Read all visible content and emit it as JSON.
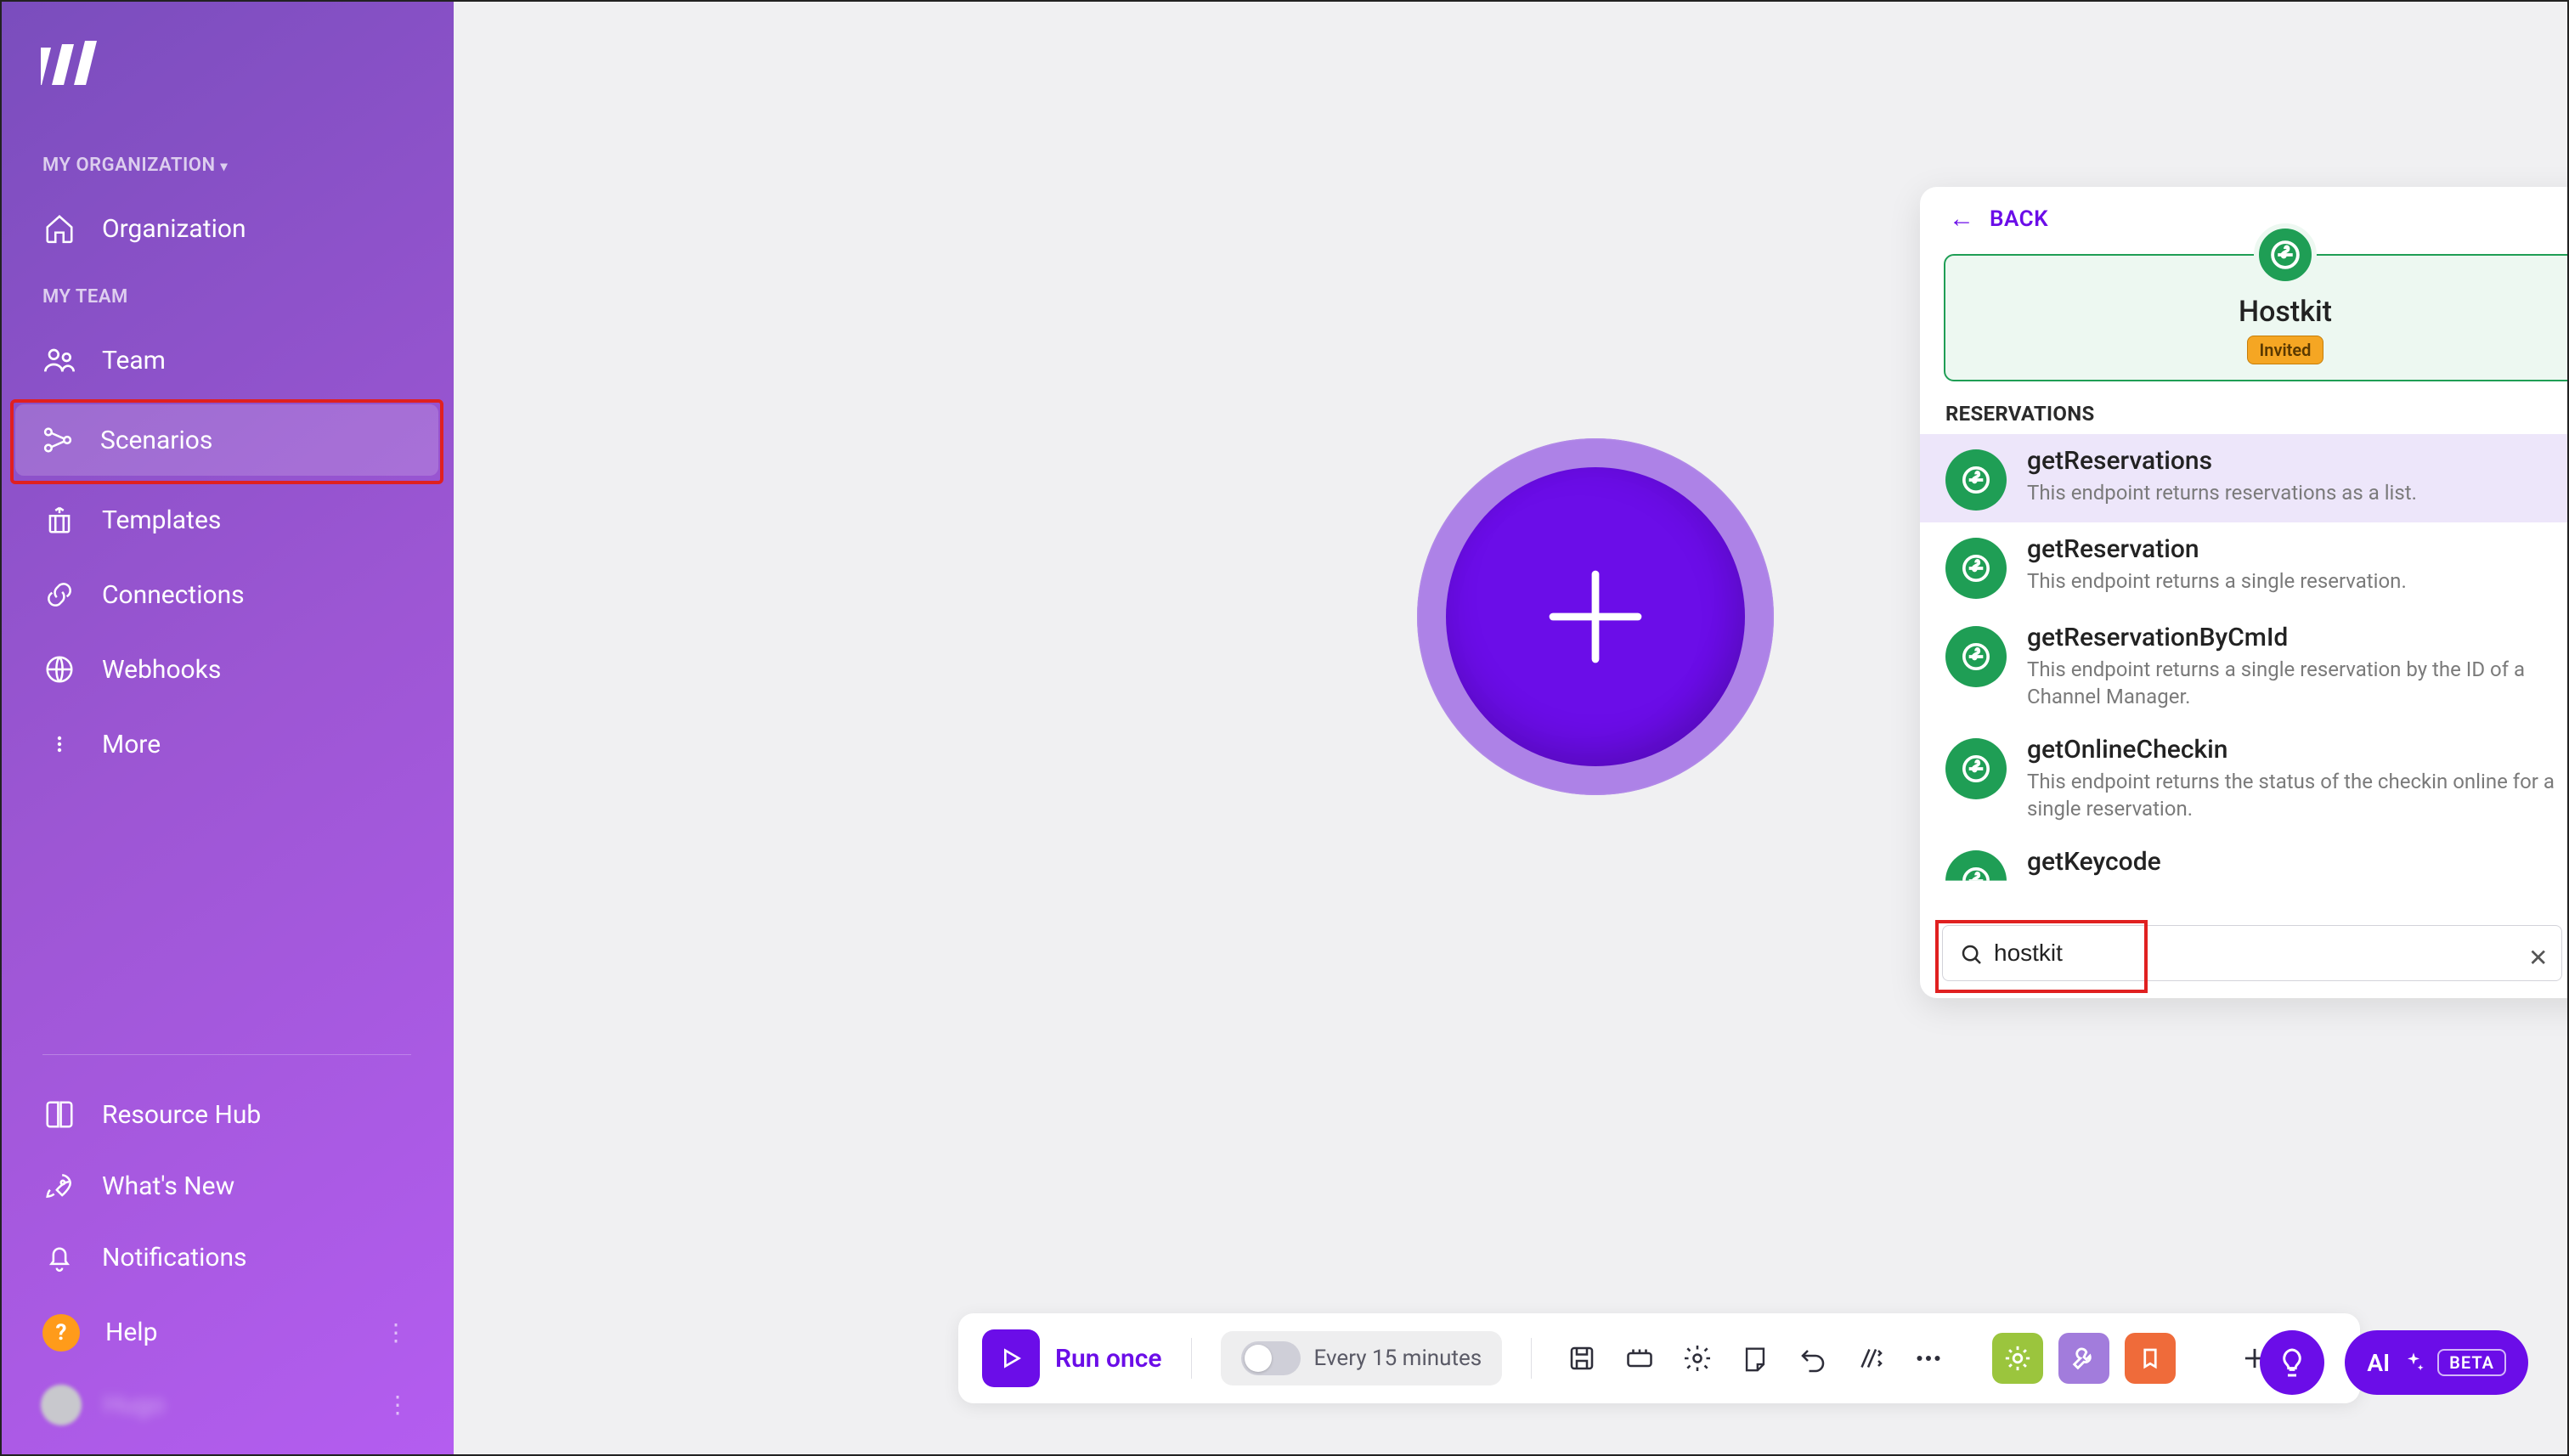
{
  "sidebar": {
    "org_section": "MY ORGANIZATION",
    "team_section": "MY TEAM",
    "organization": "Organization",
    "team": "Team",
    "scenarios": "Scenarios",
    "templates": "Templates",
    "connections": "Connections",
    "webhooks": "Webhooks",
    "more": "More",
    "resource_hub": "Resource Hub",
    "whats_new": "What's New",
    "notifications": "Notifications",
    "help": "Help",
    "help_q": "?",
    "user": "Hugo"
  },
  "popover": {
    "back": "BACK",
    "app_name": "Hostkit",
    "invited": "Invited",
    "category": "RESERVATIONS",
    "actions": [
      {
        "title": "getReservations",
        "desc": "This endpoint returns reservations as a list."
      },
      {
        "title": "getReservation",
        "desc": "This endpoint returns a single reservation."
      },
      {
        "title": "getReservationByCmId",
        "desc": "This endpoint returns a single reservation by the ID of a Channel Manager."
      },
      {
        "title": "getOnlineCheckin",
        "desc": "This endpoint returns the status of the checkin online for a single reservation."
      },
      {
        "title": "getKeycode",
        "desc": ""
      }
    ],
    "search_value": "hostkit"
  },
  "toolbar": {
    "run": "Run once",
    "schedule": "Every 15 minutes"
  },
  "fab": {
    "ai": "AI",
    "beta": "BETA"
  }
}
